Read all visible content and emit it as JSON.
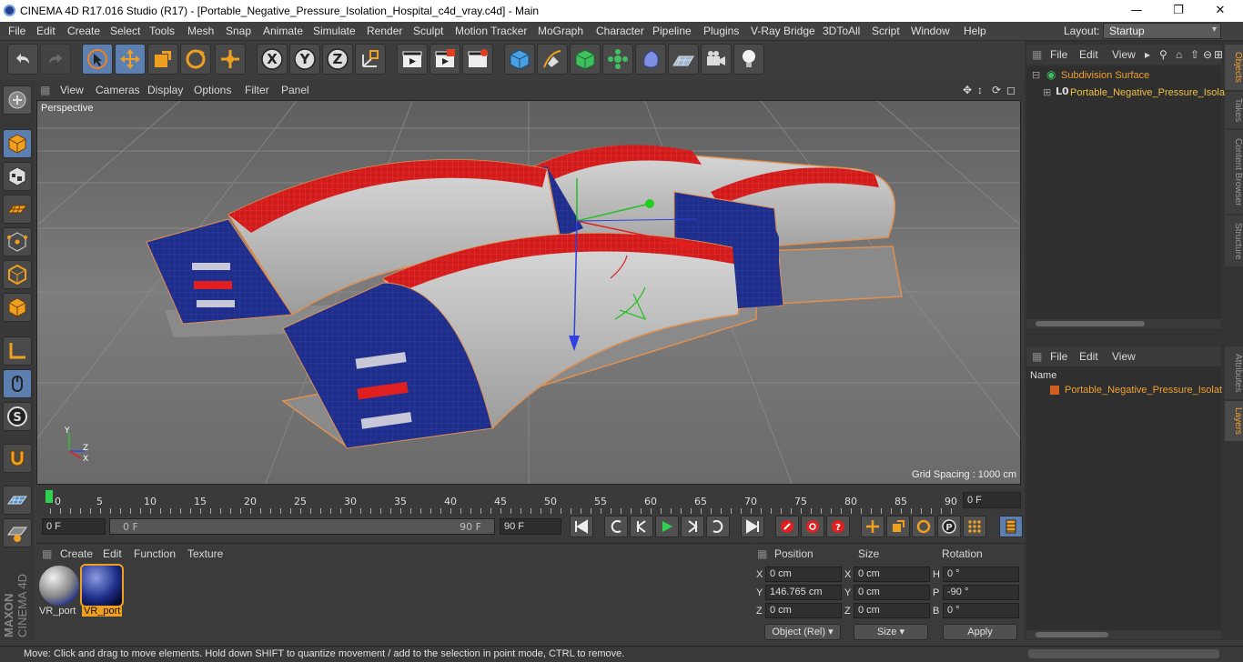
{
  "window": {
    "title": "CINEMA 4D R17.016 Studio (R17) - [Portable_Negative_Pressure_Isolation_Hospital_c4d_vray.c4d] - Main",
    "minimize": "—",
    "maximize": "❐",
    "close": "✕"
  },
  "menu": {
    "items": [
      "File",
      "Edit",
      "Create",
      "Select",
      "Tools",
      "Mesh",
      "Snap",
      "Animate",
      "Simulate",
      "Render",
      "Sculpt",
      "Motion Tracker",
      "MoGraph",
      "Character",
      "Pipeline",
      "Plugins",
      "V-Ray Bridge",
      "3DToAll",
      "Script",
      "Window",
      "Help"
    ],
    "layout_label": "Layout:",
    "layout_value": "Startup"
  },
  "viewport": {
    "menu": [
      "View",
      "Cameras",
      "Display",
      "Options",
      "Filter",
      "Panel"
    ],
    "camera_label": "Perspective",
    "grid_spacing": "Grid Spacing : 1000 cm",
    "axis_x": "X",
    "axis_y": "Y",
    "axis_z": "Z"
  },
  "timeline": {
    "ticks": [
      "0",
      "5",
      "10",
      "15",
      "20",
      "25",
      "30",
      "35",
      "40",
      "45",
      "50",
      "55",
      "60",
      "65",
      "70",
      "75",
      "80",
      "85",
      "90"
    ],
    "current_frame": "0 F",
    "start_field": "0 F",
    "range_start": "0 F",
    "range_end": "90 F",
    "end_field": "90 F"
  },
  "materials": {
    "menu": [
      "Create",
      "Edit",
      "Function",
      "Texture"
    ],
    "items": [
      {
        "label": "VR_port",
        "selected": false
      },
      {
        "label": "VR_port",
        "selected": true
      }
    ]
  },
  "coordinates": {
    "headers": [
      "Position",
      "Size",
      "Rotation"
    ],
    "rows": [
      {
        "pl": "X",
        "pv": "0 cm",
        "sl": "X",
        "sv": "0 cm",
        "rl": "H",
        "rv": "0 °"
      },
      {
        "pl": "Y",
        "pv": "146.765 cm",
        "sl": "Y",
        "sv": "0 cm",
        "rl": "P",
        "rv": "-90 °"
      },
      {
        "pl": "Z",
        "pv": "0 cm",
        "sl": "Z",
        "sv": "0 cm",
        "rl": "B",
        "rv": "0 °"
      }
    ],
    "mode": "Object (Rel)",
    "size_mode": "Size",
    "apply": "Apply"
  },
  "objects_panel": {
    "menu": [
      "File",
      "Edit",
      "View"
    ],
    "items": [
      {
        "label": "Subdivision Surface",
        "color": "#f0a030"
      },
      {
        "label": "Portable_Negative_Pressure_Isola",
        "color": "#f0c040"
      }
    ]
  },
  "layers_panel": {
    "menu": [
      "File",
      "Edit",
      "View"
    ],
    "header": "Name",
    "items": [
      {
        "label": "Portable_Negative_Pressure_Isolat",
        "color": "#f0a030"
      }
    ]
  },
  "side_tabs": {
    "top": [
      "Objects",
      "Takes",
      "Content Browser",
      "Structure"
    ],
    "bottom": [
      "Attributes",
      "Layers"
    ]
  },
  "branding": {
    "maxon": "MAXON",
    "product": "CINEMA 4D"
  },
  "status": "Move: Click and drag to move elements. Hold down SHIFT to quantize movement / add to the selection in point mode, CTRL to remove.",
  "colors": {
    "accent": "#5a7fb0",
    "highlight": "#f0a030",
    "building_blue": "#1f2f8c",
    "building_red": "#d42020"
  }
}
